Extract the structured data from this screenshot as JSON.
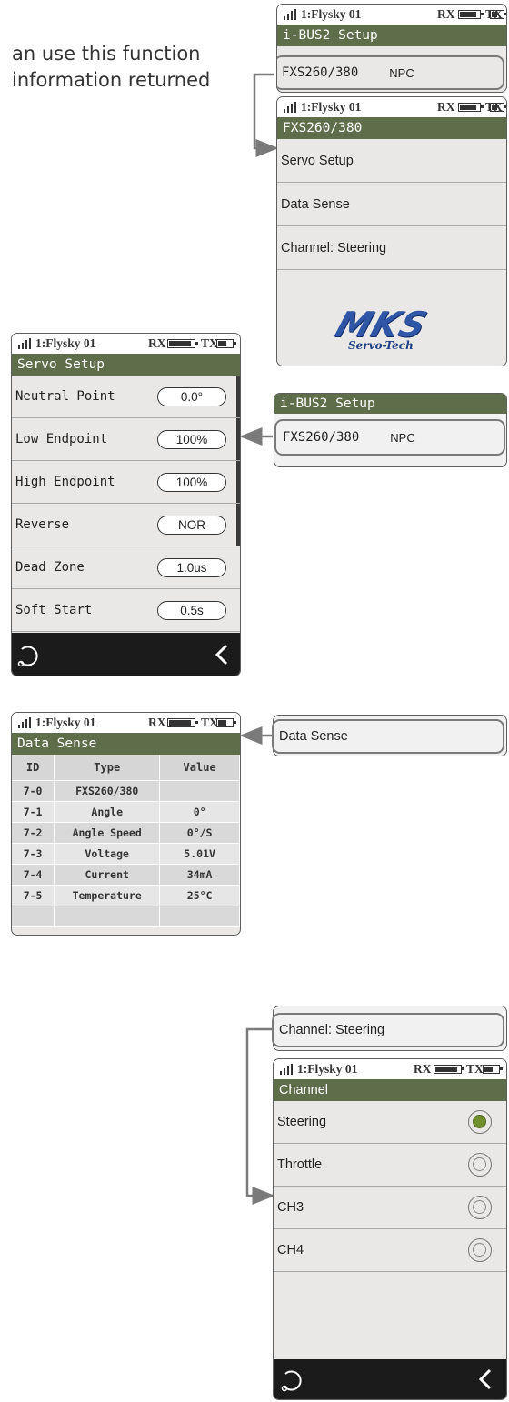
{
  "intro_text": [
    "an use this function",
    "information returned"
  ],
  "status": {
    "model": "1:Flysky 01",
    "rx": "RX",
    "tx": "TX"
  },
  "screen_a": {
    "title": "i-BUS2 Setup",
    "item": "FXS260/380",
    "item_tag": "NPC"
  },
  "screen_b": {
    "title": "FXS260/380",
    "items": [
      "Servo Setup",
      "Data Sense",
      "Channel: Steering"
    ],
    "logo_main": "MKS",
    "logo_sub": "Servo-Tech"
  },
  "callout_ibus": {
    "title": "i-BUS2 Setup",
    "item": "FXS260/380",
    "item_tag": "NPC"
  },
  "servo_setup": {
    "title": "Servo Setup",
    "rows": [
      {
        "label": "Neutral Point",
        "value": "0.0°"
      },
      {
        "label": "Low Endpoint",
        "value": "100%"
      },
      {
        "label": "High Endpoint",
        "value": "100%"
      },
      {
        "label": "Reverse",
        "value": "NOR"
      },
      {
        "label": "Dead Zone",
        "value": "1.0us"
      },
      {
        "label": "Soft Start",
        "value": "0.5s"
      }
    ]
  },
  "data_sense": {
    "title": "Data Sense",
    "headers": [
      "ID",
      "Type",
      "Value"
    ],
    "rows": [
      [
        "7-0",
        "FXS260/380",
        ""
      ],
      [
        "7-1",
        "Angle",
        "0°"
      ],
      [
        "7-2",
        "Angle Speed",
        "0°/S"
      ],
      [
        "7-3",
        "Voltage",
        "5.01V"
      ],
      [
        "7-4",
        "Current",
        "34mA"
      ],
      [
        "7-5",
        "Temperature",
        "25°C"
      ],
      [
        "",
        "",
        ""
      ]
    ]
  },
  "callout_datasense": {
    "item": "Data Sense"
  },
  "callout_channel": {
    "item": "Channel: Steering"
  },
  "channel": {
    "title": "Channel",
    "options": [
      {
        "label": "Steering",
        "selected": true
      },
      {
        "label": "Throttle",
        "selected": false
      },
      {
        "label": "CH3",
        "selected": false
      },
      {
        "label": "CH4",
        "selected": false
      }
    ]
  },
  "colors": {
    "header": "#5e6e4a",
    "radio_selected": "#6f8f2a",
    "footer": "#1b1b1b"
  },
  "icons": {
    "footer_left": "refresh-icon",
    "footer_right": "back-chevron-icon"
  }
}
